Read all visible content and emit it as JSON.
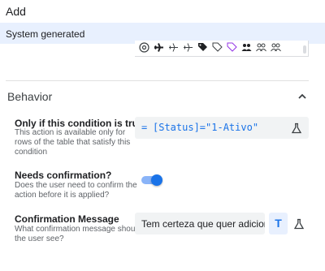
{
  "window": {
    "title": "Add"
  },
  "system_generated": {
    "label": "System generated"
  },
  "icon_picker": {
    "icons": [
      "compass-icon",
      "airplane-icon",
      "airplane-outline-icon",
      "airplane-outline-2-icon",
      "tag-icon",
      "tags-icon",
      "tag-outline-icon",
      "users-icon",
      "users-outline-icon",
      "users-outline-2-icon"
    ]
  },
  "behavior": {
    "section_title": "Behavior",
    "condition": {
      "label": "Only if this condition is true",
      "help": [
        "This action is available only for",
        "rows of the table that satisfy this",
        "condition"
      ],
      "equals_sign": "=",
      "expression": "[Status]=\"1-Ativo\""
    },
    "confirmation": {
      "label": "Needs confirmation?",
      "help": [
        "Does the user need to confirm the",
        "action before it is applied?"
      ],
      "enabled": true
    },
    "message": {
      "label": "Confirmation Message",
      "help": [
        "What confirmation message should",
        "the user see?"
      ],
      "value": "Tem certeza que quer adicion",
      "text_mode_label": "T"
    }
  },
  "colors": {
    "accent": "#1a73e8",
    "system_bar": "#e8f0fe",
    "field_bg": "#f1f3f4"
  }
}
